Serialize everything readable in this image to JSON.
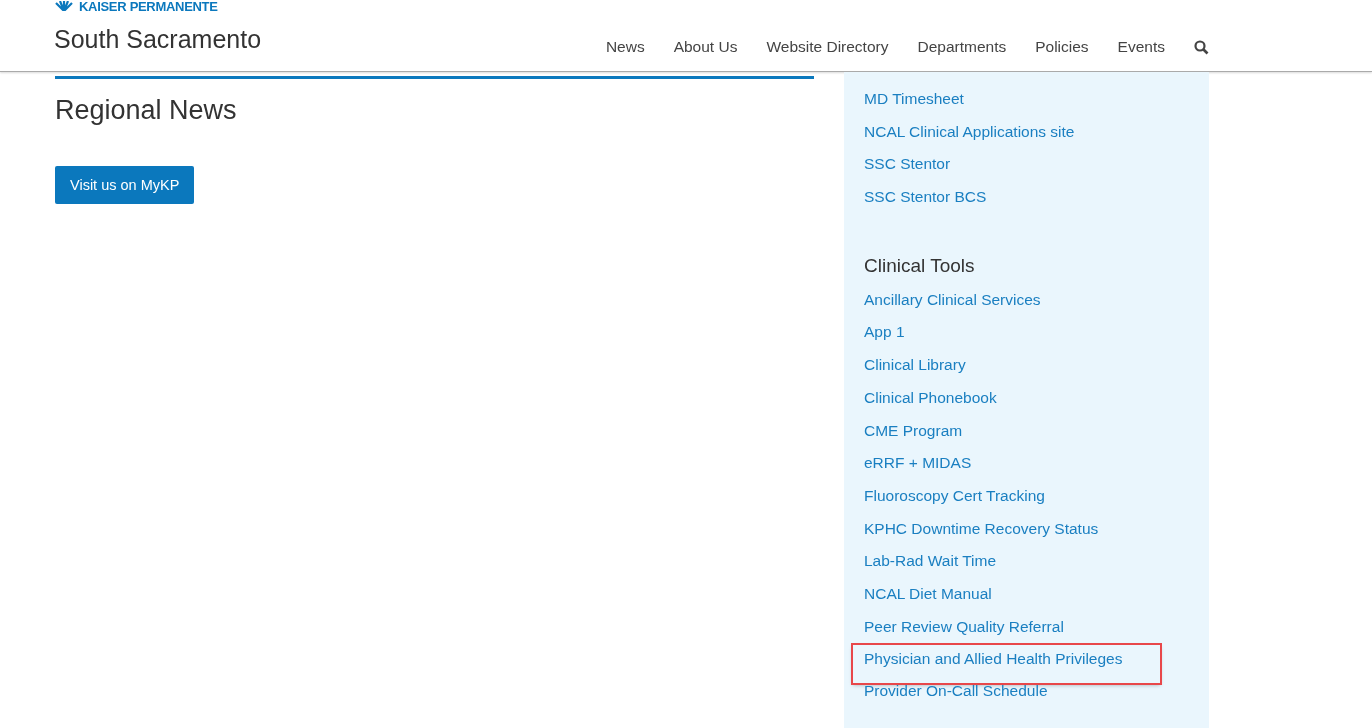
{
  "header": {
    "logo": "KAISER PERMANENTE",
    "site_title": "South Sacramento",
    "nav": [
      {
        "label": "News"
      },
      {
        "label": "About Us"
      },
      {
        "label": "Website Directory"
      },
      {
        "label": "Departments"
      },
      {
        "label": "Policies"
      },
      {
        "label": "Events"
      }
    ]
  },
  "main": {
    "heading": "Regional News",
    "button": "Visit us on MyKP"
  },
  "sidebar": {
    "groups": [
      {
        "links": [
          {
            "label": "MD Timesheet",
            "highlighted": false
          },
          {
            "label": "NCAL Clinical Applications site",
            "highlighted": false
          },
          {
            "label": "SSC Stentor",
            "highlighted": false
          },
          {
            "label": "SSC Stentor BCS",
            "highlighted": false
          }
        ]
      },
      {
        "heading": "Clinical Tools",
        "links": [
          {
            "label": "Ancillary Clinical Services",
            "highlighted": false
          },
          {
            "label": "App 1",
            "highlighted": false
          },
          {
            "label": "Clinical Library",
            "highlighted": false
          },
          {
            "label": "Clinical Phonebook",
            "highlighted": false
          },
          {
            "label": "CME Program",
            "highlighted": false
          },
          {
            "label": "eRRF + MIDAS",
            "highlighted": false
          },
          {
            "label": "Fluoroscopy Cert Tracking",
            "highlighted": false
          },
          {
            "label": "KPHC Downtime Recovery Status",
            "highlighted": false
          },
          {
            "label": "Lab-Rad Wait Time",
            "highlighted": false
          },
          {
            "label": "NCAL Diet Manual",
            "highlighted": false
          },
          {
            "label": "Peer Review Quality Referral",
            "highlighted": false
          },
          {
            "label": "Physician and Allied Health Privileges",
            "highlighted": true
          },
          {
            "label": "Provider On-Call Schedule",
            "highlighted": false
          }
        ]
      }
    ]
  }
}
